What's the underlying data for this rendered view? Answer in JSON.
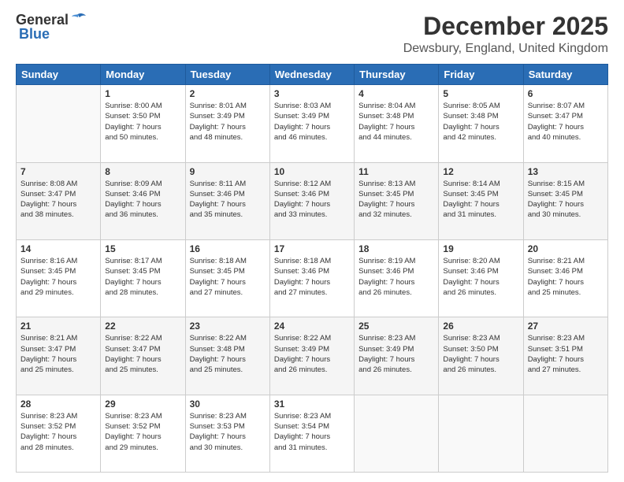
{
  "logo": {
    "general": "General",
    "blue": "Blue"
  },
  "header": {
    "month": "December 2025",
    "location": "Dewsbury, England, United Kingdom"
  },
  "weekdays": [
    "Sunday",
    "Monday",
    "Tuesday",
    "Wednesday",
    "Thursday",
    "Friday",
    "Saturday"
  ],
  "weeks": [
    [
      {
        "day": "",
        "info": ""
      },
      {
        "day": "1",
        "info": "Sunrise: 8:00 AM\nSunset: 3:50 PM\nDaylight: 7 hours\nand 50 minutes."
      },
      {
        "day": "2",
        "info": "Sunrise: 8:01 AM\nSunset: 3:49 PM\nDaylight: 7 hours\nand 48 minutes."
      },
      {
        "day": "3",
        "info": "Sunrise: 8:03 AM\nSunset: 3:49 PM\nDaylight: 7 hours\nand 46 minutes."
      },
      {
        "day": "4",
        "info": "Sunrise: 8:04 AM\nSunset: 3:48 PM\nDaylight: 7 hours\nand 44 minutes."
      },
      {
        "day": "5",
        "info": "Sunrise: 8:05 AM\nSunset: 3:48 PM\nDaylight: 7 hours\nand 42 minutes."
      },
      {
        "day": "6",
        "info": "Sunrise: 8:07 AM\nSunset: 3:47 PM\nDaylight: 7 hours\nand 40 minutes."
      }
    ],
    [
      {
        "day": "7",
        "info": "Sunrise: 8:08 AM\nSunset: 3:47 PM\nDaylight: 7 hours\nand 38 minutes."
      },
      {
        "day": "8",
        "info": "Sunrise: 8:09 AM\nSunset: 3:46 PM\nDaylight: 7 hours\nand 36 minutes."
      },
      {
        "day": "9",
        "info": "Sunrise: 8:11 AM\nSunset: 3:46 PM\nDaylight: 7 hours\nand 35 minutes."
      },
      {
        "day": "10",
        "info": "Sunrise: 8:12 AM\nSunset: 3:46 PM\nDaylight: 7 hours\nand 33 minutes."
      },
      {
        "day": "11",
        "info": "Sunrise: 8:13 AM\nSunset: 3:45 PM\nDaylight: 7 hours\nand 32 minutes."
      },
      {
        "day": "12",
        "info": "Sunrise: 8:14 AM\nSunset: 3:45 PM\nDaylight: 7 hours\nand 31 minutes."
      },
      {
        "day": "13",
        "info": "Sunrise: 8:15 AM\nSunset: 3:45 PM\nDaylight: 7 hours\nand 30 minutes."
      }
    ],
    [
      {
        "day": "14",
        "info": "Sunrise: 8:16 AM\nSunset: 3:45 PM\nDaylight: 7 hours\nand 29 minutes."
      },
      {
        "day": "15",
        "info": "Sunrise: 8:17 AM\nSunset: 3:45 PM\nDaylight: 7 hours\nand 28 minutes."
      },
      {
        "day": "16",
        "info": "Sunrise: 8:18 AM\nSunset: 3:45 PM\nDaylight: 7 hours\nand 27 minutes."
      },
      {
        "day": "17",
        "info": "Sunrise: 8:18 AM\nSunset: 3:46 PM\nDaylight: 7 hours\nand 27 minutes."
      },
      {
        "day": "18",
        "info": "Sunrise: 8:19 AM\nSunset: 3:46 PM\nDaylight: 7 hours\nand 26 minutes."
      },
      {
        "day": "19",
        "info": "Sunrise: 8:20 AM\nSunset: 3:46 PM\nDaylight: 7 hours\nand 26 minutes."
      },
      {
        "day": "20",
        "info": "Sunrise: 8:21 AM\nSunset: 3:46 PM\nDaylight: 7 hours\nand 25 minutes."
      }
    ],
    [
      {
        "day": "21",
        "info": "Sunrise: 8:21 AM\nSunset: 3:47 PM\nDaylight: 7 hours\nand 25 minutes."
      },
      {
        "day": "22",
        "info": "Sunrise: 8:22 AM\nSunset: 3:47 PM\nDaylight: 7 hours\nand 25 minutes."
      },
      {
        "day": "23",
        "info": "Sunrise: 8:22 AM\nSunset: 3:48 PM\nDaylight: 7 hours\nand 25 minutes."
      },
      {
        "day": "24",
        "info": "Sunrise: 8:22 AM\nSunset: 3:49 PM\nDaylight: 7 hours\nand 26 minutes."
      },
      {
        "day": "25",
        "info": "Sunrise: 8:23 AM\nSunset: 3:49 PM\nDaylight: 7 hours\nand 26 minutes."
      },
      {
        "day": "26",
        "info": "Sunrise: 8:23 AM\nSunset: 3:50 PM\nDaylight: 7 hours\nand 26 minutes."
      },
      {
        "day": "27",
        "info": "Sunrise: 8:23 AM\nSunset: 3:51 PM\nDaylight: 7 hours\nand 27 minutes."
      }
    ],
    [
      {
        "day": "28",
        "info": "Sunrise: 8:23 AM\nSunset: 3:52 PM\nDaylight: 7 hours\nand 28 minutes."
      },
      {
        "day": "29",
        "info": "Sunrise: 8:23 AM\nSunset: 3:52 PM\nDaylight: 7 hours\nand 29 minutes."
      },
      {
        "day": "30",
        "info": "Sunrise: 8:23 AM\nSunset: 3:53 PM\nDaylight: 7 hours\nand 30 minutes."
      },
      {
        "day": "31",
        "info": "Sunrise: 8:23 AM\nSunset: 3:54 PM\nDaylight: 7 hours\nand 31 minutes."
      },
      {
        "day": "",
        "info": ""
      },
      {
        "day": "",
        "info": ""
      },
      {
        "day": "",
        "info": ""
      }
    ]
  ]
}
